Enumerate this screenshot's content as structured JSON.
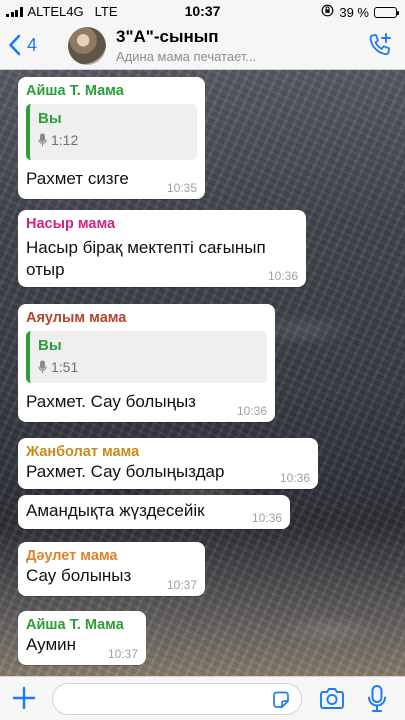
{
  "status_bar": {
    "carrier": "ALTEL4G",
    "network": "LTE",
    "time": "10:37",
    "battery": "39 %",
    "battery_level": 0.39
  },
  "header": {
    "back_count": "4",
    "title": "3\"А\"-сынып",
    "subtitle": "Адина мама печатает..."
  },
  "messages": [
    {
      "sender": "Айша Т. Мама",
      "sender_color": "#2e9d39",
      "quote_author": "Вы",
      "quote_duration": "1:12",
      "text": "Рахмет сизге",
      "time": "10:35"
    },
    {
      "sender": "Насыр мама",
      "sender_color": "#d1237a",
      "text_line1": "Насыр бірақ мектепті сағынып",
      "text_line2": "отыр",
      "time": "10:36"
    },
    {
      "sender": "Аяулым мама",
      "sender_color": "#b5442e",
      "quote_author": "Вы",
      "quote_duration": "1:51",
      "text": "Рахмет. Сау болыңыз",
      "time": "10:36"
    },
    {
      "sender": "Жанболат мама",
      "sender_color": "#c98a17",
      "text": "Рахмет. Сау болыңыздар",
      "time": "10:36"
    },
    {
      "text": "Амандықта жүздесейік",
      "time": "10:36"
    },
    {
      "sender": "Дәулет мама",
      "sender_color": "#e0822b",
      "text": "Сау болыныз",
      "time": "10:37"
    },
    {
      "sender": "Айша Т. Мама",
      "sender_color": "#2e9d39",
      "text": "Аумин",
      "time": "10:37"
    }
  ],
  "colors": {
    "accent": "#1c7cf4",
    "quote_green": "#2e9d39"
  },
  "icons": [
    "back-chevron-icon",
    "add-participant-call-icon",
    "plus-icon",
    "sticker-icon",
    "camera-icon",
    "microphone-icon",
    "voice-mic-icon",
    "signal-icon",
    "lock-rotation-icon"
  ]
}
